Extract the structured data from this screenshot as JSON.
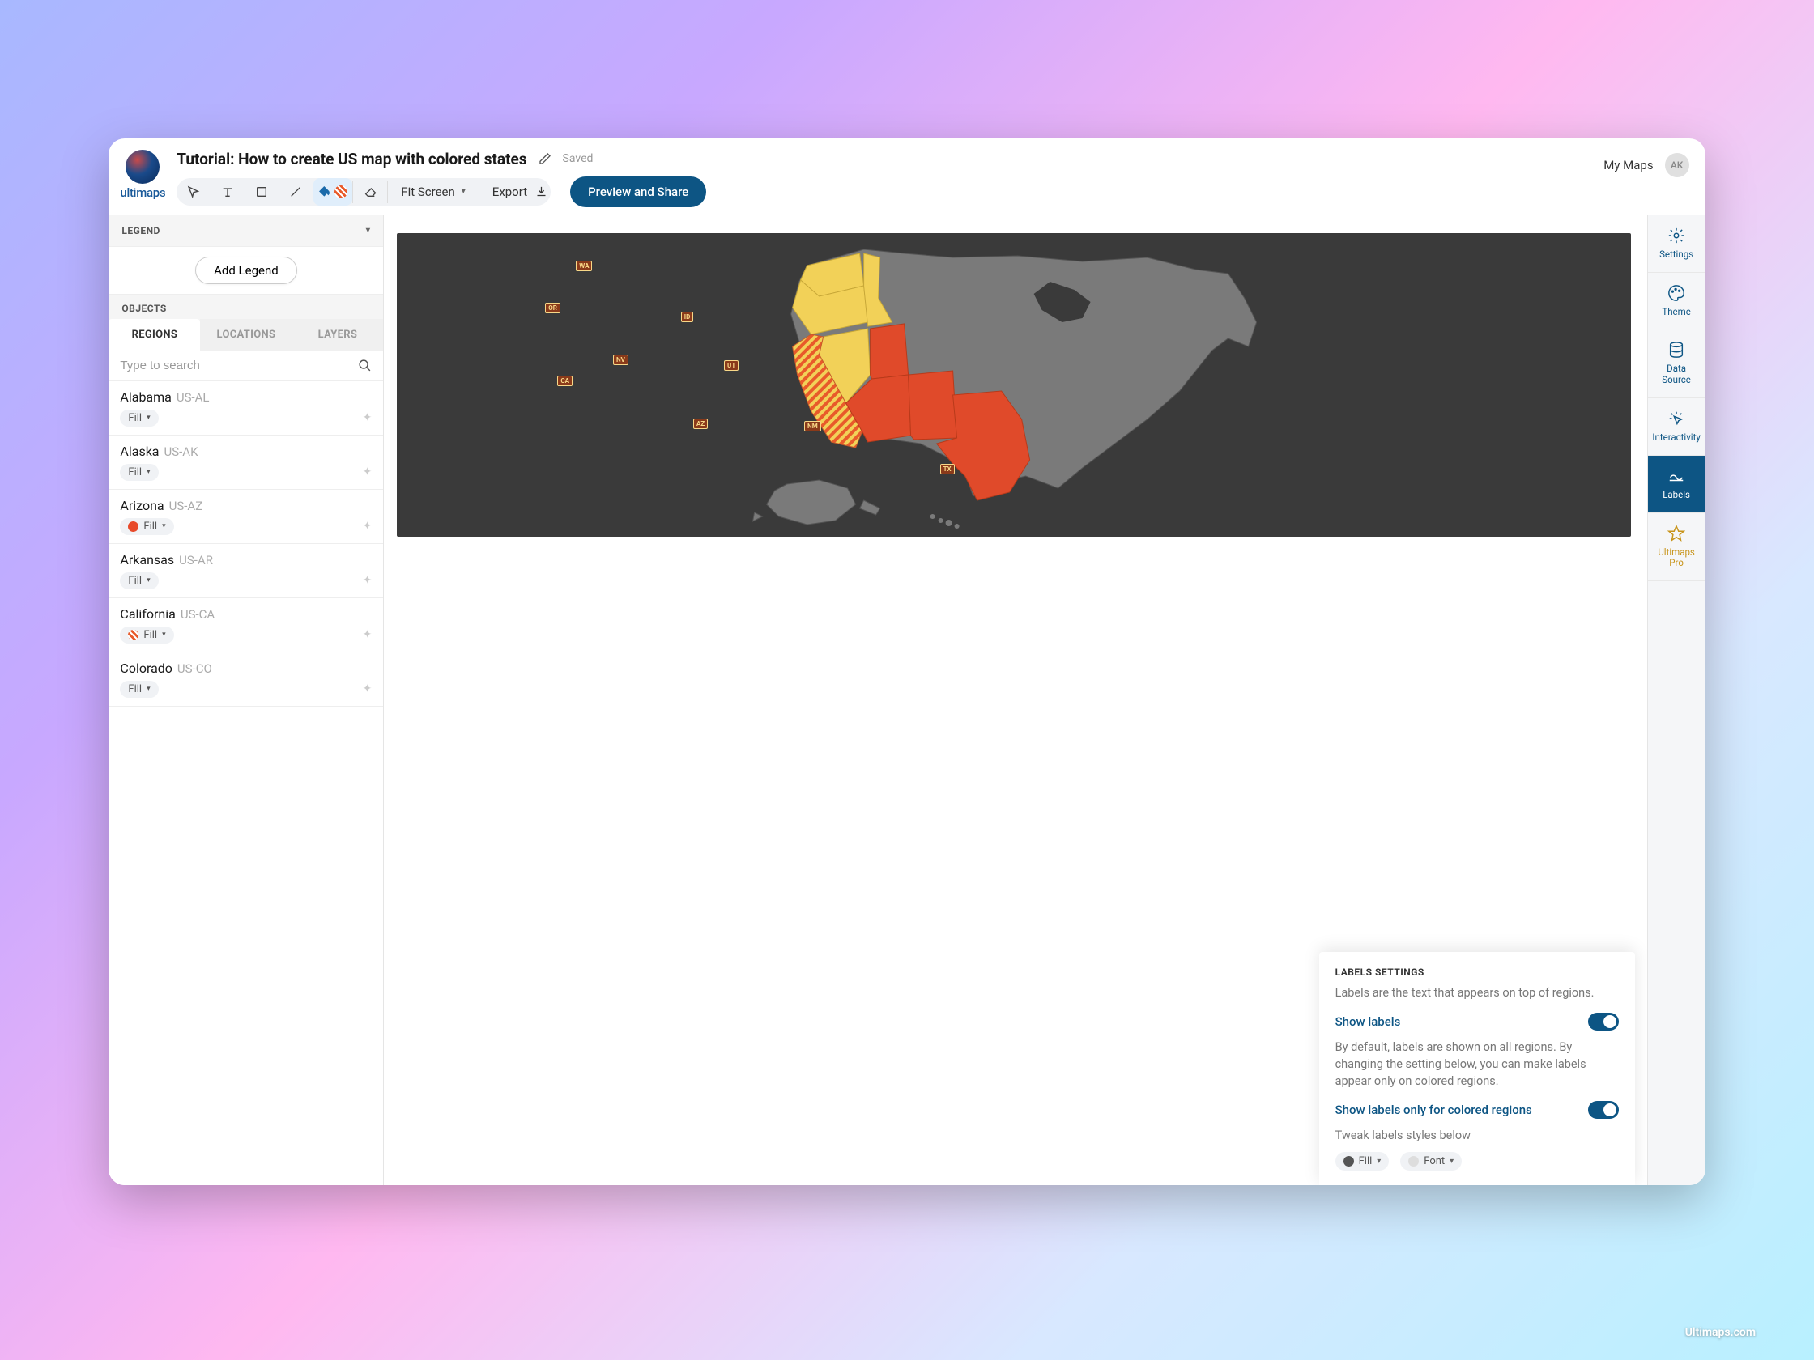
{
  "brand": "ultimaps",
  "doc_title": "Tutorial: How to create US map with colored states",
  "saved_text": "Saved",
  "my_maps": "My Maps",
  "avatar": "AK",
  "fit_screen": "Fit Screen",
  "export": "Export",
  "preview_share": "Preview and Share",
  "sidebar": {
    "legend": "LEGEND",
    "add_legend": "Add Legend",
    "objects": "OBJECTS",
    "tabs": {
      "regions": "REGIONS",
      "locations": "LOCATIONS",
      "layers": "LAYERS"
    },
    "search_placeholder": "Type to search"
  },
  "regions": [
    {
      "name": "Alabama",
      "code": "US-AL",
      "fill": "Fill",
      "swatch": null
    },
    {
      "name": "Alaska",
      "code": "US-AK",
      "fill": "Fill",
      "swatch": null
    },
    {
      "name": "Arizona",
      "code": "US-AZ",
      "fill": "Fill",
      "swatch": "#e84a2a"
    },
    {
      "name": "Arkansas",
      "code": "US-AR",
      "fill": "Fill",
      "swatch": null
    },
    {
      "name": "California",
      "code": "US-CA",
      "fill": "Fill",
      "swatch": "stripe"
    },
    {
      "name": "Colorado",
      "code": "US-CO",
      "fill": "Fill",
      "swatch": null
    }
  ],
  "map_labels": [
    "WA",
    "OR",
    "ID",
    "NV",
    "UT",
    "CA",
    "AZ",
    "NM",
    "TX"
  ],
  "labels_panel": {
    "title": "LABELS SETTINGS",
    "subtitle": "Labels are the text that appears on top of regions.",
    "show_labels": "Show labels",
    "desc": "By default, labels are shown on all regions. By changing the setting below, you can make labels appear only on colored regions.",
    "show_colored": "Show labels only for colored regions",
    "tweak": "Tweak labels styles below",
    "chip_fill": "Fill",
    "chip_font": "Font"
  },
  "rail": {
    "settings": "Settings",
    "theme": "Theme",
    "data_source": "Data\nSource",
    "interactivity": "Interactivity",
    "labels": "Labels",
    "pro": "Ultimaps\nPro"
  },
  "footer_credit": "Ultimaps.com",
  "colors": {
    "accent": "#0d5584",
    "orange": "#e85a2a",
    "yellow": "#f2d158",
    "gold": "#c8941a"
  }
}
